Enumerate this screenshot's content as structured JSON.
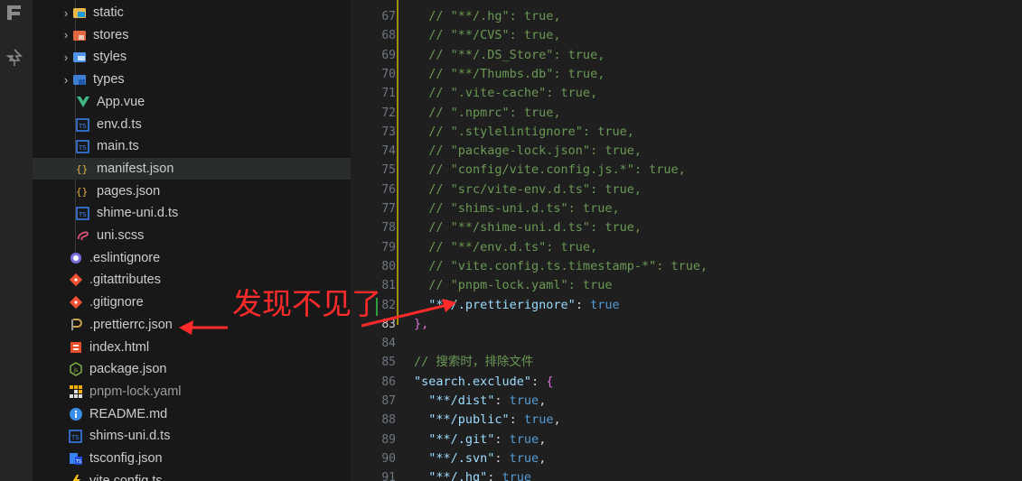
{
  "explorer": {
    "items": [
      {
        "label": "static",
        "kind": "folder",
        "icon": "folder-static-icon",
        "expanded": false
      },
      {
        "label": "stores",
        "kind": "folder",
        "icon": "folder-stores-icon",
        "expanded": false
      },
      {
        "label": "styles",
        "kind": "folder",
        "icon": "folder-styles-icon",
        "expanded": false
      },
      {
        "label": "types",
        "kind": "folder",
        "icon": "folder-types-icon",
        "expanded": false
      },
      {
        "label": "App.vue",
        "kind": "file",
        "icon": "vue-icon"
      },
      {
        "label": "env.d.ts",
        "kind": "file",
        "icon": "ts-icon"
      },
      {
        "label": "main.ts",
        "kind": "file",
        "icon": "ts-icon"
      },
      {
        "label": "manifest.json",
        "kind": "file",
        "icon": "json-icon",
        "selected": true
      },
      {
        "label": "pages.json",
        "kind": "file",
        "icon": "json-icon"
      },
      {
        "label": "shime-uni.d.ts",
        "kind": "file",
        "icon": "ts-icon"
      },
      {
        "label": "uni.scss",
        "kind": "file",
        "icon": "sass-icon"
      },
      {
        "label": ".eslintignore",
        "kind": "file",
        "icon": "eslint-icon"
      },
      {
        "label": ".gitattributes",
        "kind": "file",
        "icon": "git-icon"
      },
      {
        "label": ".gitignore",
        "kind": "file",
        "icon": "git-icon"
      },
      {
        "label": ".prettierrc.json",
        "kind": "file",
        "icon": "prettier-icon"
      },
      {
        "label": "index.html",
        "kind": "file",
        "icon": "html-icon"
      },
      {
        "label": "package.json",
        "kind": "file",
        "icon": "node-icon"
      },
      {
        "label": "pnpm-lock.yaml",
        "kind": "file",
        "icon": "pnpm-icon",
        "dim": true
      },
      {
        "label": "README.md",
        "kind": "file",
        "icon": "info-icon"
      },
      {
        "label": "shims-uni.d.ts",
        "kind": "file",
        "icon": "ts-icon"
      },
      {
        "label": "tsconfig.json",
        "kind": "file",
        "icon": "tsconfig-icon"
      },
      {
        "label": "vite.config.ts",
        "kind": "file",
        "icon": "vite-icon"
      }
    ]
  },
  "editor": {
    "current_line": 83,
    "lines": [
      {
        "n": 67,
        "parts": [
          [
            "c-com",
            "  // \"**/.hg\": true,"
          ]
        ]
      },
      {
        "n": 68,
        "parts": [
          [
            "c-com",
            "  // \"**/CVS\": true,"
          ]
        ]
      },
      {
        "n": 69,
        "parts": [
          [
            "c-com",
            "  // \"**/.DS_Store\": true,"
          ]
        ]
      },
      {
        "n": 70,
        "parts": [
          [
            "c-com",
            "  // \"**/Thumbs.db\": true,"
          ]
        ]
      },
      {
        "n": 71,
        "parts": [
          [
            "c-com",
            "  // \".vite-cache\": true,"
          ]
        ]
      },
      {
        "n": 72,
        "parts": [
          [
            "c-com",
            "  // \".npmrc\": true,"
          ]
        ]
      },
      {
        "n": 73,
        "parts": [
          [
            "c-com",
            "  // \".stylelintignore\": true,"
          ]
        ]
      },
      {
        "n": 74,
        "parts": [
          [
            "c-com",
            "  // \"package-lock.json\": true,"
          ]
        ]
      },
      {
        "n": 75,
        "parts": [
          [
            "c-com",
            "  // \"config/vite.config.js.*\": true,"
          ]
        ]
      },
      {
        "n": 76,
        "parts": [
          [
            "c-com",
            "  // \"src/vite-env.d.ts\": true,"
          ]
        ]
      },
      {
        "n": 77,
        "parts": [
          [
            "c-com",
            "  // \"shims-uni.d.ts\": true,"
          ]
        ]
      },
      {
        "n": 78,
        "parts": [
          [
            "c-com",
            "  // \"**/shime-uni.d.ts\": true,"
          ]
        ]
      },
      {
        "n": 79,
        "parts": [
          [
            "c-com",
            "  // \"**/env.d.ts\": true,"
          ]
        ]
      },
      {
        "n": 80,
        "parts": [
          [
            "c-com",
            "  // \"vite.config.ts.timestamp-*\": true,"
          ]
        ]
      },
      {
        "n": 81,
        "parts": [
          [
            "c-com",
            "  // \"pnpm-lock.yaml\": true"
          ]
        ]
      },
      {
        "n": 82,
        "parts": [
          [
            "c-key",
            "  \"**/.prettierignore\""
          ],
          [
            "c-punc",
            ": "
          ],
          [
            "c-bool",
            "true"
          ]
        ]
      },
      {
        "n": 83,
        "parts": [
          [
            "c-brace",
            "},"
          ]
        ]
      },
      {
        "n": 84,
        "parts": [
          [
            "c-punc",
            ""
          ]
        ]
      },
      {
        "n": 85,
        "parts": [
          [
            "c-com",
            "// 搜索时，排除文件"
          ]
        ]
      },
      {
        "n": 86,
        "parts": [
          [
            "c-key",
            "\"search.exclude\""
          ],
          [
            "c-punc",
            ": "
          ],
          [
            "c-brace",
            "{"
          ]
        ]
      },
      {
        "n": 87,
        "parts": [
          [
            "c-key",
            "  \"**/dist\""
          ],
          [
            "c-punc",
            ": "
          ],
          [
            "c-bool",
            "true"
          ],
          [
            "c-punc",
            ","
          ]
        ]
      },
      {
        "n": 88,
        "parts": [
          [
            "c-key",
            "  \"**/public\""
          ],
          [
            "c-punc",
            ": "
          ],
          [
            "c-bool",
            "true"
          ],
          [
            "c-punc",
            ","
          ]
        ]
      },
      {
        "n": 89,
        "parts": [
          [
            "c-key",
            "  \"**/.git\""
          ],
          [
            "c-punc",
            ": "
          ],
          [
            "c-bool",
            "true"
          ],
          [
            "c-punc",
            ","
          ]
        ]
      },
      {
        "n": 90,
        "parts": [
          [
            "c-key",
            "  \"**/.svn\""
          ],
          [
            "c-punc",
            ": "
          ],
          [
            "c-bool",
            "true"
          ],
          [
            "c-punc",
            ","
          ]
        ]
      },
      {
        "n": 91,
        "parts": [
          [
            "c-key",
            "  \"**/.hg\""
          ],
          [
            "c-punc",
            ": "
          ],
          [
            "c-bool",
            "true"
          ]
        ]
      }
    ]
  },
  "annotation": {
    "text": "发现不见了",
    "color": "#ff2a2a"
  },
  "colors": {
    "comment": "#6a9955",
    "key": "#9cdcfe",
    "boolean": "#569cd6"
  }
}
